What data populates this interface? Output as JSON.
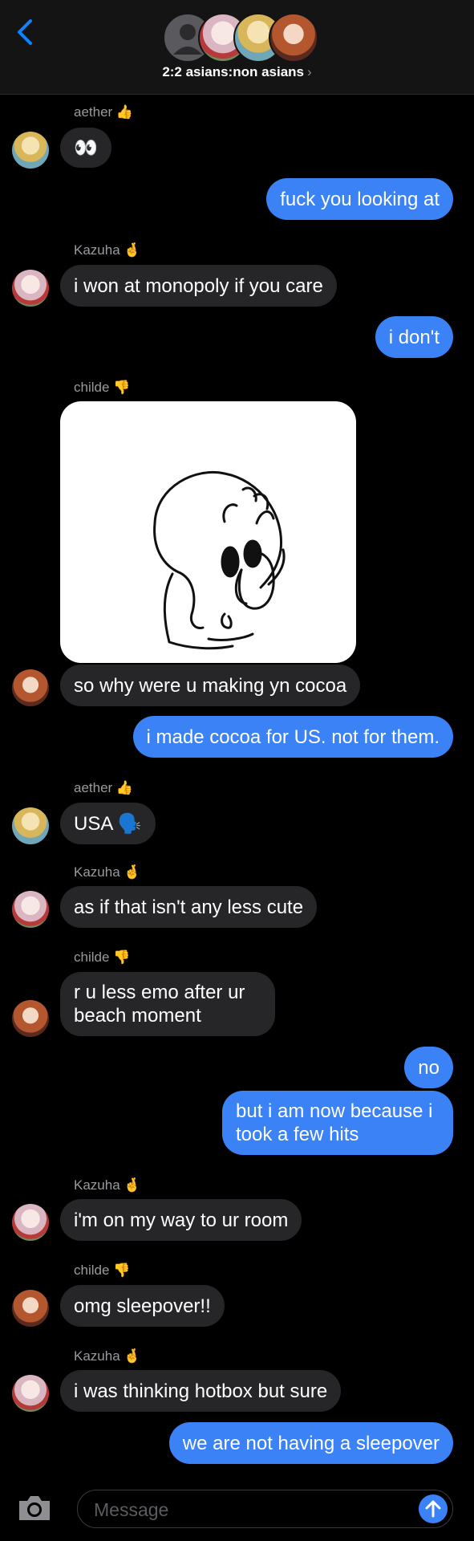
{
  "header": {
    "title": "2:2 asians:non asians",
    "chevron": "›",
    "back_icon": "chevron-left-icon"
  },
  "colors": {
    "outgoing": "#3b82f6",
    "incoming": "#262628",
    "background": "#000000",
    "header_bg": "#141414"
  },
  "messages": {
    "m1_name": "aether 👍",
    "m1_text": "👀",
    "m2_text": "fuck you looking at",
    "m3_name": "Kazuha 🤞",
    "m3_text": "i won at monopoly if you care",
    "m4_text": "i don't",
    "m5_name": "childe 👎",
    "m6_text": "so why were u making yn cocoa",
    "m7_text": "i made cocoa for US. not for them.",
    "m8_name": "aether 👍",
    "m8_text": "USA 🗣️",
    "m9_name": "Kazuha 🤞",
    "m9_text": "as if that isn't any less cute",
    "m10_name": "childe 👎",
    "m10_text": "r u less emo after ur beach moment",
    "m11_text": "no",
    "m12_text": "but i am now because i took a few hits",
    "m13_name": "Kazuha 🤞",
    "m13_text": "i'm on my way to ur room",
    "m14_name": "childe 👎",
    "m14_text": "omg sleepover!!",
    "m15_name": "Kazuha 🤞",
    "m15_text": "i was thinking hotbox but sure",
    "m16_text": "we are not having a sleepover"
  },
  "composer": {
    "placeholder": "Message",
    "camera_icon": "camera-icon",
    "send_icon": "arrow-up-icon"
  }
}
